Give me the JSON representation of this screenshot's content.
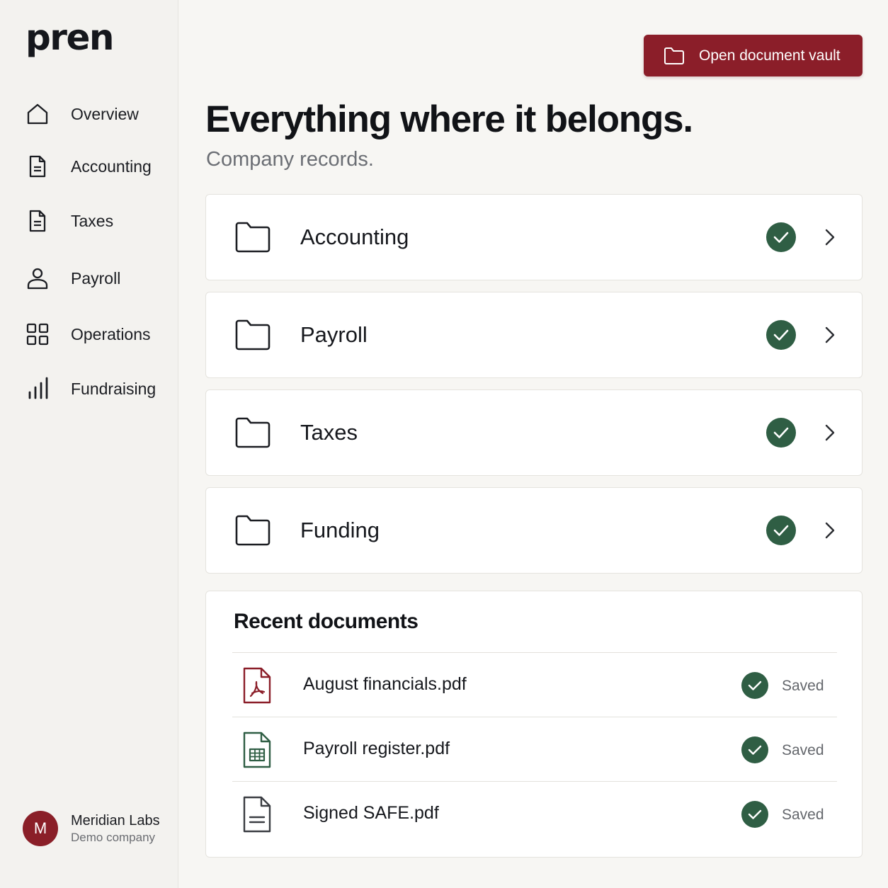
{
  "brand": {
    "logo_text": "pren"
  },
  "sidebar": {
    "items": [
      {
        "label": "Overview",
        "icon": "home-icon"
      },
      {
        "label": "Accounting",
        "icon": "document-icon"
      },
      {
        "label": "Taxes",
        "icon": "document-icon"
      },
      {
        "label": "Payroll",
        "icon": "user-icon"
      },
      {
        "label": "Operations",
        "icon": "grid-icon"
      },
      {
        "label": "Fundraising",
        "icon": "bar-chart-icon"
      }
    ],
    "org": {
      "avatar_initial": "M",
      "name": "Meridian Labs",
      "subtitle": "Demo company"
    }
  },
  "header": {
    "vault_button_label": "Open document vault",
    "title": "Everything where it belongs.",
    "subtitle": "Company records."
  },
  "folders": [
    {
      "label": "Accounting",
      "status": "complete"
    },
    {
      "label": "Payroll",
      "status": "complete"
    },
    {
      "label": "Taxes",
      "status": "complete"
    },
    {
      "label": "Funding",
      "status": "complete"
    }
  ],
  "recent": {
    "title": "Recent documents",
    "docs": [
      {
        "name": "August financials.pdf",
        "status": "Saved",
        "icon": "pdf-file-icon"
      },
      {
        "name": "Payroll register.pdf",
        "status": "Saved",
        "icon": "spreadsheet-file-icon"
      },
      {
        "name": "Signed SAFE.pdf",
        "status": "Saved",
        "icon": "text-file-icon"
      }
    ]
  },
  "colors": {
    "accent": "#8b1e29",
    "success": "#2f5e44",
    "background": "#f7f6f3",
    "sidebar": "#f3f2ef"
  }
}
